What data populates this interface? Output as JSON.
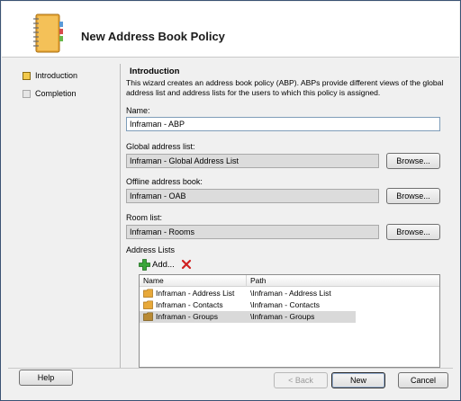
{
  "header": {
    "title": "New Address Book Policy",
    "icon": "address-book-icon"
  },
  "nav": {
    "items": [
      {
        "label": "Introduction",
        "state": "active"
      },
      {
        "label": "Completion",
        "state": "pending"
      }
    ]
  },
  "content": {
    "section_title": "Introduction",
    "description": "This wizard creates an address book policy (ABP). ABPs provide different views of the global address list and address lists for the users to which this policy is assigned.",
    "name": {
      "label": "Name:",
      "value": "Inframan - ABP"
    },
    "gal": {
      "label": "Global address list:",
      "value": "Inframan - Global Address List",
      "browse": "Browse..."
    },
    "oab": {
      "label": "Offline address book:",
      "value": "Inframan - OAB",
      "browse": "Browse..."
    },
    "room": {
      "label": "Room list:",
      "value": "Inframan - Rooms",
      "browse": "Browse..."
    },
    "address_lists": {
      "label": "Address Lists",
      "add_label": "Add...",
      "columns": [
        "Name",
        "Path"
      ],
      "rows": [
        {
          "name": "Inframan - Address List",
          "path": "\\Inframan - Address List",
          "selected": false
        },
        {
          "name": "Inframan - Contacts",
          "path": "\\Inframan - Contacts",
          "selected": false
        },
        {
          "name": "Inframan - Groups",
          "path": "\\Inframan - Groups",
          "selected": true
        }
      ]
    }
  },
  "footer": {
    "help": "Help",
    "back": "< Back",
    "next": "New",
    "cancel": "Cancel"
  },
  "colors": {
    "accent_active": "#f2c94c",
    "folder": "#e8a93a",
    "add_icon": "#3aa63a",
    "remove_icon": "#d02020"
  }
}
